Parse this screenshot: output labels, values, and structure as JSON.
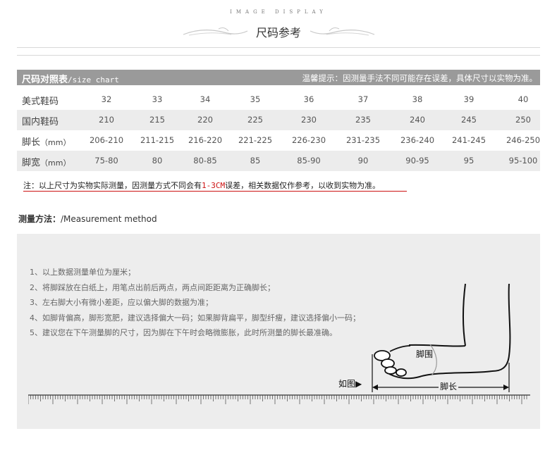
{
  "header": {
    "image_display": "IMAGE DISPLAY",
    "title": "尺码参考"
  },
  "size_table": {
    "title": "尺码对照表",
    "title_sub": "/size chart",
    "tip": "温馨提示：因测量手法不同可能存在误差，具体尺寸以实物为准。",
    "rows": [
      {
        "label": "美式鞋码",
        "unit": "",
        "values": [
          "32",
          "33",
          "34",
          "35",
          "36",
          "37",
          "38",
          "39",
          "40"
        ]
      },
      {
        "label": "国内鞋码",
        "unit": "",
        "values": [
          "210",
          "215",
          "220",
          "225",
          "230",
          "235",
          "240",
          "245",
          "250"
        ]
      },
      {
        "label": "脚长",
        "unit": "（mm）",
        "values": [
          "206-210",
          "211-215",
          "216-220",
          "221-225",
          "226-230",
          "231-235",
          "236-240",
          "241-245",
          "246-250"
        ]
      },
      {
        "label": "脚宽",
        "unit": "（mm）",
        "values": [
          "75-80",
          "80",
          "80-85",
          "85",
          "85-90",
          "90",
          "90-95",
          "95",
          "95-100"
        ]
      }
    ]
  },
  "note": {
    "prefix": "注：以上尺寸为实物实际测量，因测量方式不同会有",
    "range": "1-3CM",
    "suffix": "误差，相关数据仅作参考，以收到实物为准。"
  },
  "method": {
    "title": "测量方法：",
    "subtitle": "/Measurement method"
  },
  "steps": [
    "1、以上数据测量单位为厘米；",
    "2、将脚踩放在白纸上，用笔点出前后两点，两点间距距离为正确脚长；",
    "3、左右脚大小有微小差距，应以偏大脚的数据为准；",
    "4、如脚背偏高，脚形宽肥，建议选择偏大一码；如果脚背扁平，脚型纤瘦，建议选择偏小一码；",
    "5、建议您在下午测量脚的尺寸，因为脚在下午时会略微膨胀，此时所测量的脚长最准确。"
  ],
  "diagram": {
    "circumference_label": "脚围",
    "length_label": "脚长",
    "example_label": "如图"
  }
}
